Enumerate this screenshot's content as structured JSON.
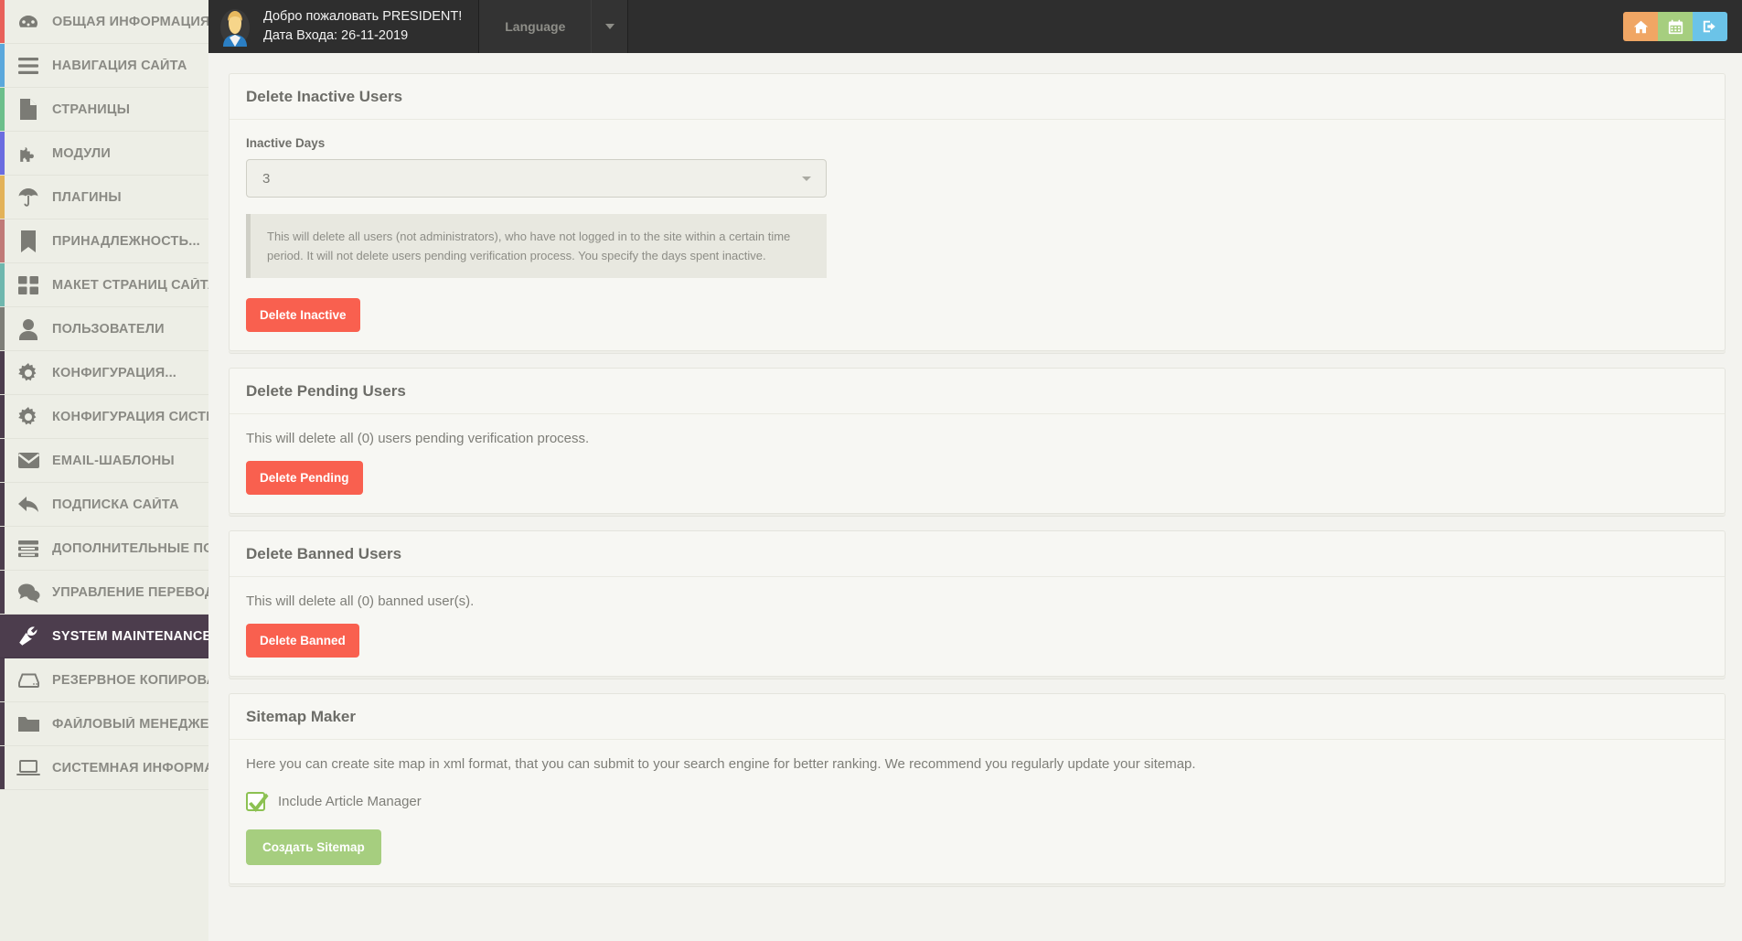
{
  "sidebar": {
    "items": [
      {
        "label": "ОБЩАЯ ИНФОРМАЦИЯ",
        "icon": "dashboard-icon",
        "stripe": "#e8615a",
        "active": false
      },
      {
        "label": "НАВИГАЦИЯ САЙТА",
        "icon": "menu-icon",
        "stripe": "#5ba8dc",
        "active": false
      },
      {
        "label": "СТРАНИЦЫ",
        "icon": "page-icon",
        "stripe": "#6cbf8b",
        "active": false
      },
      {
        "label": "МОДУЛИ",
        "icon": "puzzle-icon",
        "stripe": "#6b6ce0",
        "active": false
      },
      {
        "label": "ПЛАГИНЫ",
        "icon": "umbrella-icon",
        "stripe": "#e3b259",
        "active": false
      },
      {
        "label": "ПРИНАДЛЕЖНОСТЬ...",
        "icon": "bookmark-icon",
        "stripe": "#c07a78",
        "active": false
      },
      {
        "label": "МАКЕТ СТРАНИЦ САЙТА",
        "icon": "grid-icon",
        "stripe": "#6fb7ae",
        "active": false
      },
      {
        "label": "ПОЛЬЗОВАТЕЛИ",
        "icon": "user-icon",
        "stripe": "#7e7e78",
        "active": false
      },
      {
        "label": "КОНФИГУРАЦИЯ...",
        "icon": "gear-icon",
        "stripe": "#4c3d4d",
        "active": false
      },
      {
        "label": "КОНФИГУРАЦИЯ СИСТЕМЫ",
        "icon": "gear-icon",
        "stripe": "#4c3d4d",
        "active": false
      },
      {
        "label": "EMAIL-ШАБЛОНЫ",
        "icon": "envelope-icon",
        "stripe": "#4c3d4d",
        "active": false
      },
      {
        "label": "ПОДПИСКА САЙТА",
        "icon": "reply-arrow-icon",
        "stripe": "#4c3d4d",
        "active": false
      },
      {
        "label": "ДОПОЛНИТЕЛЬНЫЕ ПОЛЯ",
        "icon": "list-icon",
        "stripe": "#4c3d4d",
        "active": false
      },
      {
        "label": "УПРАВЛЕНИЕ ПЕРЕВОДАМИ",
        "icon": "comments-icon",
        "stripe": "#4c3d4d",
        "active": false
      },
      {
        "label": "SYSTEM MAINTENANCE",
        "icon": "wrench-icon",
        "stripe": "#4c3d4d",
        "active": true
      },
      {
        "label": "РЕЗЕРВНОЕ КОПИРОВАНИЕ",
        "icon": "hdd-icon",
        "stripe": "#4c3d4d",
        "active": false
      },
      {
        "label": "ФАЙЛОВЫЙ МЕНЕДЖЕР",
        "icon": "folder-icon",
        "stripe": "#4c3d4d",
        "active": false
      },
      {
        "label": "СИСТЕМНАЯ ИНФОРМАЦИЯ",
        "icon": "laptop-icon",
        "stripe": "#4c3d4d",
        "active": false
      }
    ]
  },
  "topbar": {
    "welcome_line1": "Добро пожаловать PRESIDENT!",
    "welcome_line2": "Дата Входа: 26-11-2019",
    "language_label": "Language",
    "actions": [
      {
        "name": "home-button",
        "icon": "home-icon",
        "color": "#f0a664"
      },
      {
        "name": "calendar-button",
        "icon": "calendar-icon",
        "color": "#a6ce7f"
      },
      {
        "name": "logout-button",
        "icon": "logout-icon",
        "color": "#6bc3e8"
      }
    ]
  },
  "panels": {
    "inactive": {
      "title": "Delete Inactive Users",
      "field_label": "Inactive Days",
      "select_value": "3",
      "helper_text": "This will delete all users (not administrators), who have not logged in to the site within a certain time period. It will not delete users pending verification process. You specify the days spent inactive.",
      "button_label": "Delete Inactive"
    },
    "pending": {
      "title": "Delete Pending Users",
      "description": "This will delete all (0) users pending verification process.",
      "button_label": "Delete Pending"
    },
    "banned": {
      "title": "Delete Banned Users",
      "description": "This will delete all (0) banned user(s).",
      "button_label": "Delete Banned"
    },
    "sitemap": {
      "title": "Sitemap Maker",
      "description": "Here you can create site map in xml format, that you can submit to your search engine for better ranking. We recommend you regularly update your sitemap.",
      "checkbox_label": "Include Article Manager",
      "checkbox_checked": true,
      "button_label": "Создать Sitemap"
    }
  },
  "colors": {
    "danger": "#f9604f",
    "success": "#a6ce7f",
    "active_nav": "#4c3d4d",
    "topbar_bg": "#2e2e2e"
  }
}
